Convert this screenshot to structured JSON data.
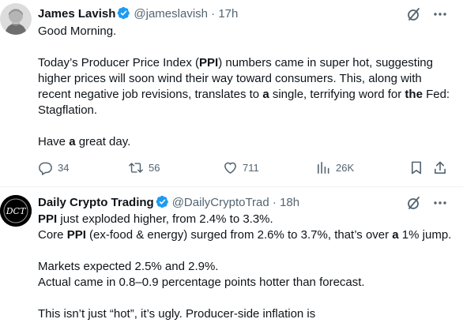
{
  "tweets": [
    {
      "author_name": "James Lavish",
      "handle": "@jameslavish",
      "separator": "·",
      "time": "17h",
      "text": {
        "line1": "Good Morning.",
        "p2_a": "Today’s Producer Price Index (",
        "p2_b": "PPI",
        "p2_c": ") numbers came in super hot, suggesting higher prices will soon wind their way toward consumers. This, along with recent negative job revisions, translates to ",
        "p2_d": "a",
        "p2_e": " single, terrifying word for ",
        "p2_f": "the",
        "p2_g": " Fed: Stagflation.",
        "p3_a": "Have ",
        "p3_b": "a",
        "p3_c": " great day."
      },
      "stats": {
        "replies": "34",
        "reposts": "56",
        "likes": "711",
        "views": "26K"
      }
    },
    {
      "author_name": "Daily Crypto Trading",
      "handle": "@DailyCryptoTrad",
      "separator": "·",
      "time": "18h",
      "avatar_text": "DCT",
      "text": {
        "l1_a": "PPI",
        "l1_b": " just exploded higher, from 2.4% to 3.3%.",
        "l2_a": "Core ",
        "l2_b": "PPI",
        "l2_c": " (ex-food & energy) surged from 2.6% to 3.7%, that’s over ",
        "l2_d": "a",
        "l2_e": " 1% jump.",
        "l3": "Markets expected 2.5% and 2.9%.",
        "l4": "Actual came in 0.8–0.9 percentage points hotter than forecast.",
        "l5": "This isn’t just “hot”, it’s ugly. Producer-side inflation is"
      }
    }
  ],
  "colors": {
    "verified": "#1d9bf0",
    "secondary_text": "#536471",
    "divider": "#eff3f4"
  }
}
